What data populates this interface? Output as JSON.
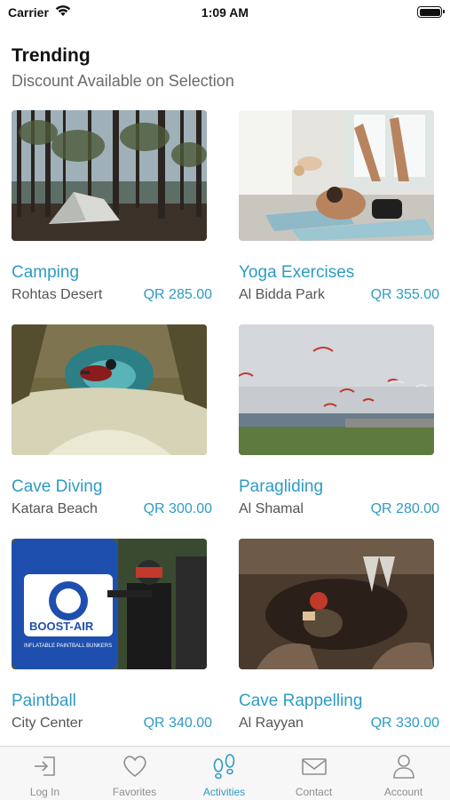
{
  "status_bar": {
    "carrier": "Carrier",
    "time": "1:09 AM"
  },
  "header": {
    "title": "Trending",
    "subtitle": "Discount Available on Selection"
  },
  "activities": [
    {
      "title": "Camping",
      "location": "Rohtas Desert",
      "price": "QR 285.00",
      "image": "camping-photo"
    },
    {
      "title": "Yoga Exercises",
      "location": "Al Bidda Park",
      "price": "QR 355.00",
      "image": "yoga-photo"
    },
    {
      "title": "Cave Diving",
      "location": "Katara Beach",
      "price": "QR 300.00",
      "image": "cave-diving-photo"
    },
    {
      "title": "Paragliding",
      "location": "Al Shamal",
      "price": "QR 280.00",
      "image": "paragliding-photo"
    },
    {
      "title": "Paintball",
      "location": "City Center",
      "price": "QR 340.00",
      "image": "paintball-photo"
    },
    {
      "title": "Cave Rappelling",
      "location": "Al Rayyan",
      "price": "QR 330.00",
      "image": "cave-rappelling-photo"
    }
  ],
  "tabs": [
    {
      "label": "Log In",
      "icon": "login-icon",
      "active": false
    },
    {
      "label": "Favorites",
      "icon": "heart-icon",
      "active": false
    },
    {
      "label": "Activities",
      "icon": "footprints-icon",
      "active": true
    },
    {
      "label": "Contact",
      "icon": "envelope-icon",
      "active": false
    },
    {
      "label": "Account",
      "icon": "person-icon",
      "active": false
    }
  ],
  "colors": {
    "accent": "#2e9bc4",
    "inactive": "#8e8e93",
    "subtitle": "#6b6b6b"
  },
  "paintball_image_text": {
    "brand": "BOOST-AIR",
    "tagline": "INFLATABLE PAINTBALL BUNKERS"
  }
}
